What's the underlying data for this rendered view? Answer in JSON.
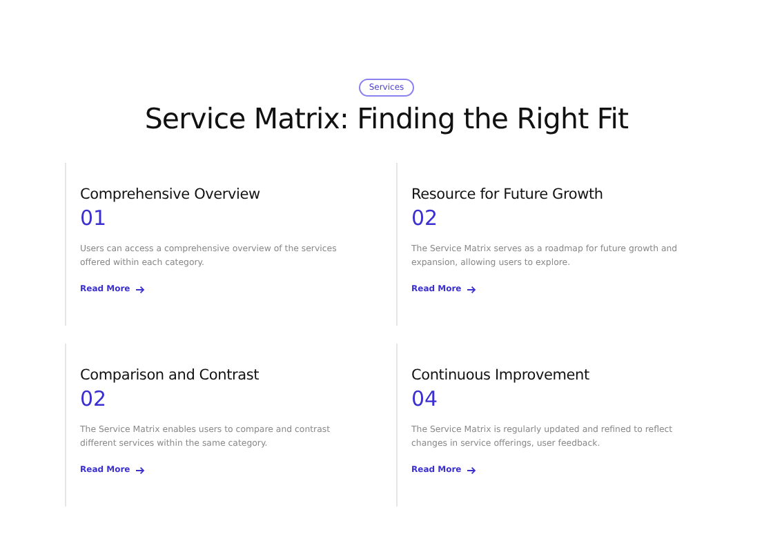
{
  "badge": "Services",
  "heading": "Service Matrix: Finding the Right Fit",
  "cards": [
    {
      "title": "Comprehensive Overview",
      "number": "01",
      "description": "Users can access a comprehensive overview of the services offered within each category.",
      "link": "Read More"
    },
    {
      "title": "Resource for Future Growth",
      "number": "02",
      "description": "The Service Matrix serves as a roadmap for future growth and expansion, allowing users to explore.",
      "link": "Read More"
    },
    {
      "title": "Comparison and Contrast",
      "number": "02",
      "description": "The Service Matrix enables users to compare and contrast different services within the same category.",
      "link": "Read More"
    },
    {
      "title": "Continuous Improvement",
      "number": "04",
      "description": "The Service Matrix is regularly updated and refined to reflect changes in service offerings, user feedback.",
      "link": "Read More"
    }
  ]
}
